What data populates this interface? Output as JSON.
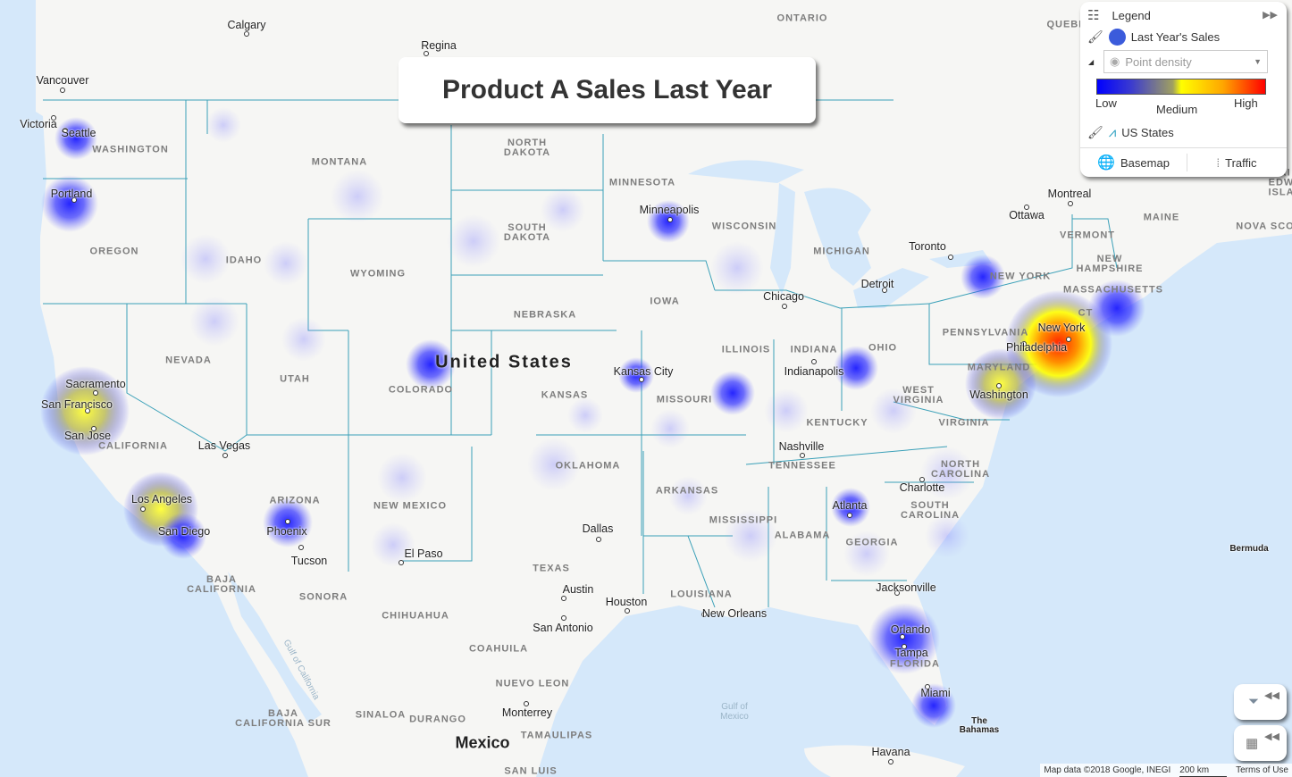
{
  "title": "Product A Sales Last Year",
  "legend": {
    "header": "Legend",
    "layer1": "Last Year's Sales",
    "layer1_color": "#3b5bdb",
    "renderer": "Point density",
    "low": "Low",
    "medium": "Medium",
    "high": "High",
    "layer2": "US States",
    "basemap": "Basemap",
    "traffic": "Traffic",
    "gradient_colors": [
      "#0000ff",
      "#ffff00",
      "#ff0000"
    ]
  },
  "map": {
    "country_us": "United States",
    "country_mx": "Mexico",
    "states": [
      "WASHINGTON",
      "MONTANA",
      "NORTH\nDAKOTA",
      "MINNESOTA",
      "SOUTH\nDAKOTA",
      "OREGON",
      "IDAHO",
      "WYOMING",
      "WISCONSIN",
      "MICHIGAN",
      "NEW YORK",
      "VERMONT",
      "NEW\nHAMPSHIRE",
      "MASSACHUSETTS",
      "MAINE",
      "IOWA",
      "NEBRASKA",
      "PENNSYLVANIA",
      "OHIO",
      "INDIANA",
      "ILLINOIS",
      "NEVADA",
      "UTAH",
      "COLORADO",
      "KANSAS",
      "MISSOURI",
      "WEST\nVIRGINIA",
      "KENTUCKY",
      "VIRGINIA",
      "CALIFORNIA",
      "TENNESSEE",
      "NORTH\nCAROLINA",
      "OKLAHOMA",
      "ARKANSAS",
      "ARIZONA",
      "NEW MEXICO",
      "SOUTH\nCAROLINA",
      "MISSISSIPPI",
      "ALABAMA",
      "GEORGIA",
      "TEXAS",
      "LOUISIANA",
      "FLORIDA",
      "MARYLAND",
      "CT",
      "ONTARIO",
      "QUEBEC",
      "NOVA SCO",
      "PRI\nEDW\nISLA",
      "BAJA\nCALIFORNIA",
      "SONORA",
      "CHIHUAHUA",
      "COAHUILA",
      "NUEVO LEON",
      "BAJA\nCALIFORNIA SUR",
      "SINALOA",
      "DURANGO",
      "TAMAULIPAS",
      "SAN LUIS"
    ],
    "cities": [
      "Calgary",
      "Regina",
      "Vancouver",
      "Victoria",
      "Seattle",
      "Portland",
      "Minneapolis",
      "Montreal",
      "Ottawa",
      "Toronto",
      "Detroit",
      "Chicago",
      "Sacramento",
      "San Francisco",
      "San Jose",
      "Las Vegas",
      "Kansas City",
      "Indianapolis",
      "Nashville",
      "Los Angeles",
      "San Diego",
      "Phoenix",
      "Tucson",
      "El Paso",
      "Dallas",
      "Charlotte",
      "Atlanta",
      "Austin",
      "Houston",
      "San Antonio",
      "New Orleans",
      "Jacksonville",
      "Orlando",
      "Tampa",
      "Miami",
      "Havana",
      "Monterrey",
      "New York",
      "Philadelphia",
      "Washington",
      "Bermuda",
      "The\nBahamas"
    ],
    "water": [
      "Gulf of\nMexico",
      "Gulf of California"
    ]
  },
  "attribution": {
    "data": "Map data ©2018 Google, INEGI",
    "scale": "200 km",
    "terms": "Terms of Use"
  }
}
